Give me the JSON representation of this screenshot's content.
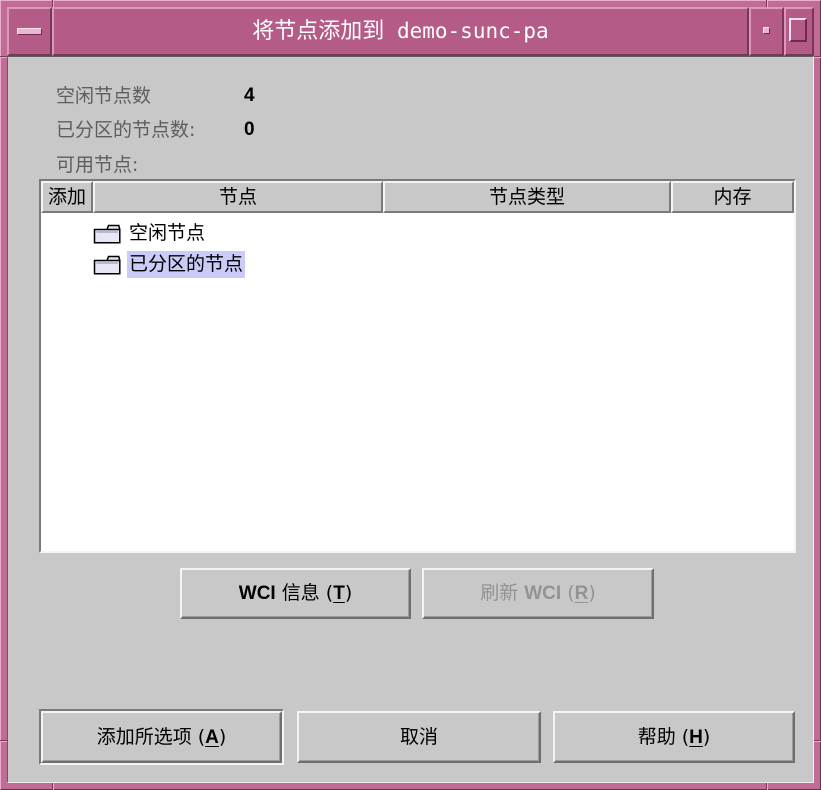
{
  "window": {
    "title": "将节点添加到 demo-sunc-pa",
    "menu_button_icon": "window-menu-icon",
    "minimize_button_icon": "minimize-icon",
    "maximize_button_icon": "maximize-icon"
  },
  "colors": {
    "frame": "#c06c95",
    "title_bar": "#b45b87",
    "title_text": "#ffffff",
    "dialog_background": "#c8c8c8",
    "label_text": "#5e5e5e",
    "table_background": "#ffffff",
    "selection": "#cbcbf7",
    "disabled_text": "#939393"
  },
  "summary": {
    "free_nodes": {
      "label": "空闲节点数",
      "value": 4
    },
    "partitioned_nodes": {
      "label": "已分区的节点数:",
      "value": 0
    },
    "available_nodes_label": "可用节点:"
  },
  "table": {
    "columns": [
      "添加",
      "节点",
      "节点类型",
      "内存"
    ],
    "rows": [
      {
        "icon": "folder-icon",
        "label": "空闲节点",
        "selected": false
      },
      {
        "icon": "folder-icon",
        "label": "已分区的节点",
        "selected": true
      }
    ]
  },
  "wci_buttons": {
    "info": {
      "label": "WCI 信息 (T)",
      "mnemonic": "T",
      "enabled": true
    },
    "refresh": {
      "label": "刷新 WCI (R)",
      "mnemonic": "R",
      "enabled": false
    }
  },
  "action_buttons": {
    "add_selected": {
      "label": "添加所选项 (A)",
      "mnemonic": "A",
      "enabled": true,
      "default": true
    },
    "cancel": {
      "label": "取消",
      "enabled": true
    },
    "help": {
      "label": "帮助 (H)",
      "mnemonic": "H",
      "enabled": true
    }
  }
}
